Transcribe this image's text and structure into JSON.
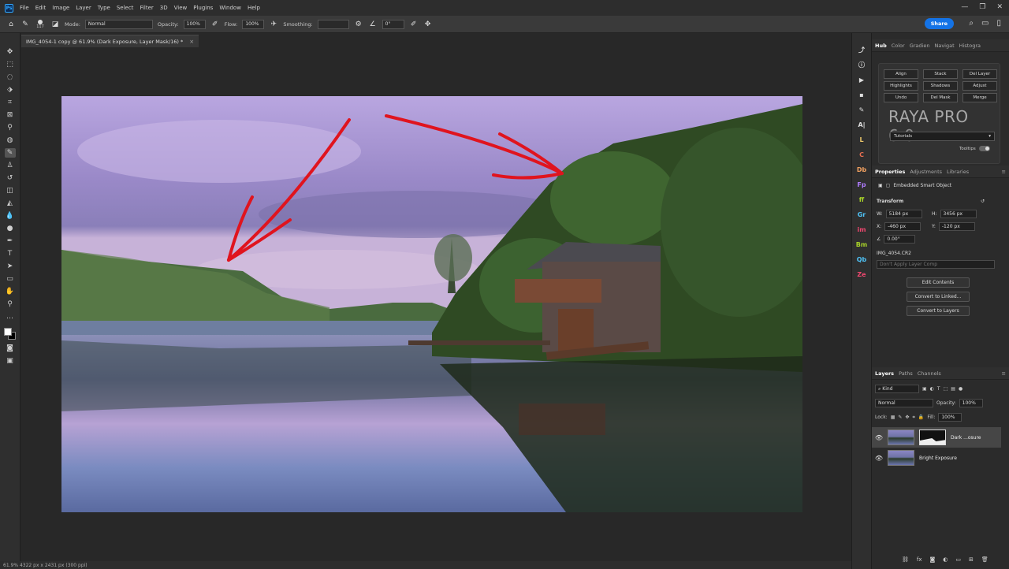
{
  "menubar": {
    "logo": "Ps",
    "items": [
      "File",
      "Edit",
      "Image",
      "Layer",
      "Type",
      "Select",
      "Filter",
      "3D",
      "View",
      "Plugins",
      "Window",
      "Help"
    ]
  },
  "options": {
    "brush_size": "117",
    "mode_label": "Mode:",
    "mode_value": "Normal",
    "opacity_label": "Opacity:",
    "opacity_value": "100%",
    "flow_label": "Flow:",
    "flow_value": "100%",
    "smoothing_label": "Smoothing:",
    "smoothing_value": "",
    "angle_value": "0°",
    "share_label": "Share"
  },
  "document": {
    "tab_title": "IMG_4054-1 copy @ 61.9% (Dark Exposure, Layer Mask/16) *",
    "close": "×"
  },
  "status": {
    "text": "61.9%    4322 px x 2431 px (300 ppi)"
  },
  "hub": {
    "tabs": [
      "Hub",
      "Color",
      "Gradien",
      "Navigat",
      "Histogra"
    ],
    "buttons": [
      "Align",
      "Stack",
      "Del Layer",
      "Highlights",
      "Shadows",
      "Adjust",
      "Undo",
      "Del Mask",
      "Merge"
    ],
    "title": "RAYA PRO",
    "version": "6.0",
    "select_value": "Tutorials",
    "tooltips_label": "Tooltips"
  },
  "properties": {
    "tabs": [
      "Properties",
      "Adjustments",
      "Libraries"
    ],
    "object_type": "Embedded Smart Object",
    "transform_label": "Transform",
    "w_label": "W:",
    "w_value": "5184 px",
    "h_label": "H:",
    "h_value": "3456 px",
    "x_label": "X:",
    "x_value": "-460 px",
    "y_label": "Y:",
    "y_value": "-120 px",
    "angle_value": "0.00°",
    "source_file": "IMG_4054.CR2",
    "comp_placeholder": "Don't Apply Layer Comp",
    "btn_edit": "Edit Contents",
    "btn_linked": "Convert to Linked...",
    "btn_layers": "Convert to Layers"
  },
  "layers": {
    "tabs": [
      "Layers",
      "Paths",
      "Channels"
    ],
    "kind_label": "Kind",
    "blend_mode": "Normal",
    "opacity_label": "Opacity:",
    "opacity_value": "100%",
    "lock_label": "Lock:",
    "fill_label": "Fill:",
    "fill_value": "100%",
    "items": [
      {
        "name": "Dark ...osure"
      },
      {
        "name": "Bright Exposure"
      }
    ]
  },
  "colors": {
    "accent": "#1473e6",
    "arrow": "#e0141e"
  }
}
